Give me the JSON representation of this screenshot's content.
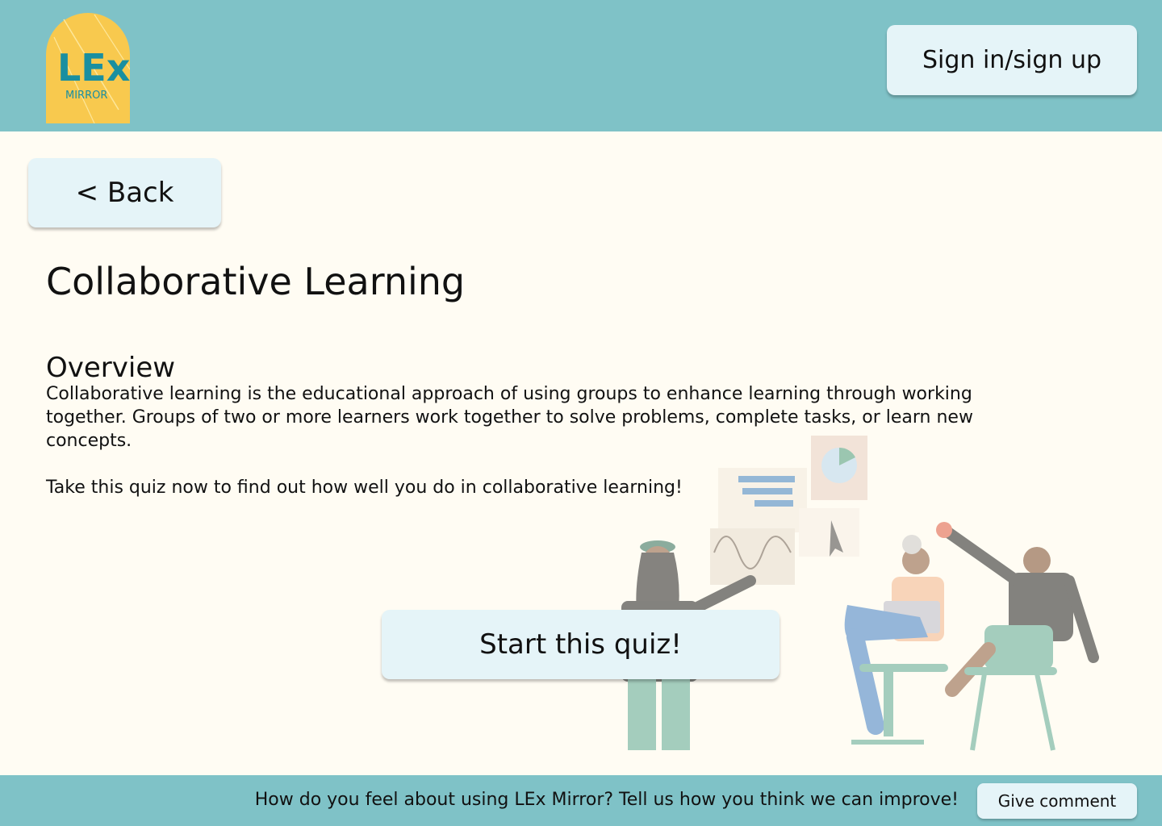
{
  "header": {
    "logo": {
      "title": "LEx",
      "subtitle": "MIRROR",
      "color": "#f8c94e"
    },
    "signin_label": "Sign in/sign up"
  },
  "nav": {
    "back_label": "< Back"
  },
  "main": {
    "title": "Collaborative Learning",
    "section_title": "Overview",
    "overview_text": "Collaborative learning is the educational approach of using groups to enhance learning through working together. Groups of two or more learners work together to solve problems, complete tasks, or learn new concepts.",
    "cta_text": "Take this quiz now to find out how well you do in collaborative learning!",
    "start_label": "Start this quiz!"
  },
  "footer": {
    "prompt": "How do you feel about using LEx Mirror? Tell us how you think we can improve!",
    "comment_label": "Give comment"
  },
  "colors": {
    "header_bg": "#7fc2c7",
    "page_bg": "#fffcf3",
    "button_bg": "#e5f4f8",
    "logo_bg": "#f8c94e",
    "logo_text": "#1a8fa0"
  }
}
